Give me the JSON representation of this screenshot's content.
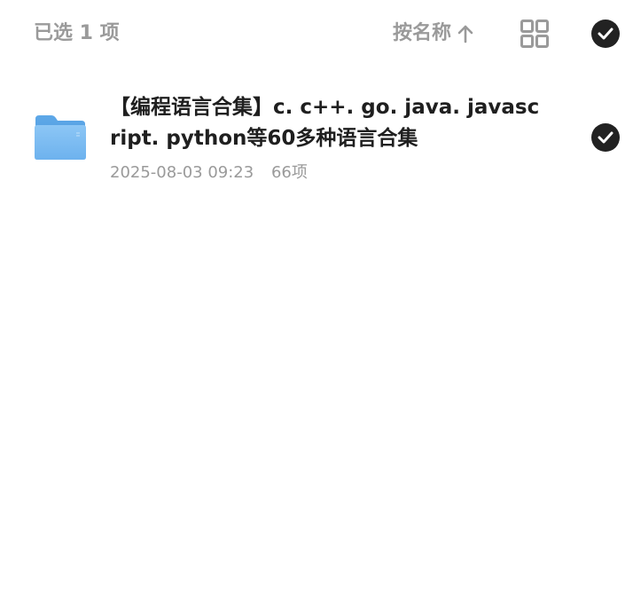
{
  "header": {
    "selected_text": "已选 1 项",
    "sort_label": "按名称",
    "sort_icon": "arrow-up-icon",
    "view_icon": "grid-view-icon",
    "select_all_icon": "check-circle-icon"
  },
  "files": [
    {
      "name": "【编程语言合集】c. c++. go. java. javascript. python等60多种语言合集",
      "date": "2025-08-03 09:23",
      "count": "66项",
      "type_icon": "folder-icon",
      "selected": true
    }
  ],
  "colors": {
    "muted_text": "#9a9a9a",
    "primary_text": "#1f1f1f",
    "check_fill": "#222222",
    "folder_blue": "#5aa9ec"
  }
}
